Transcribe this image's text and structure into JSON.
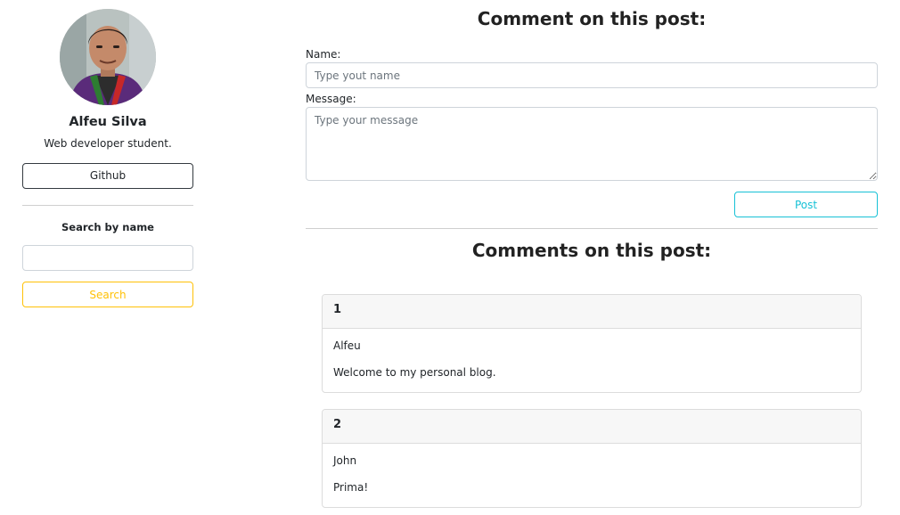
{
  "profile": {
    "name": "Alfeu Silva",
    "description": "Web developer student.",
    "github_label": "Github"
  },
  "search": {
    "label": "Search by name",
    "value": "",
    "placeholder": "",
    "button_label": "Search"
  },
  "comment_form": {
    "title": "Comment on this post:",
    "name_label": "Name:",
    "name_placeholder": "Type yout name",
    "name_value": "",
    "message_label": "Message:",
    "message_placeholder": "Type your message",
    "message_value": "",
    "post_label": "Post"
  },
  "comments_section": {
    "title": "Comments on this post:",
    "comments": [
      {
        "number": "1",
        "author": "Alfeu",
        "text": "Welcome to my personal blog."
      },
      {
        "number": "2",
        "author": "John",
        "text": "Prima!"
      }
    ]
  },
  "colors": {
    "post_accent": "#17c1d6",
    "search_accent": "#ffc107",
    "github_border": "#343a40"
  }
}
